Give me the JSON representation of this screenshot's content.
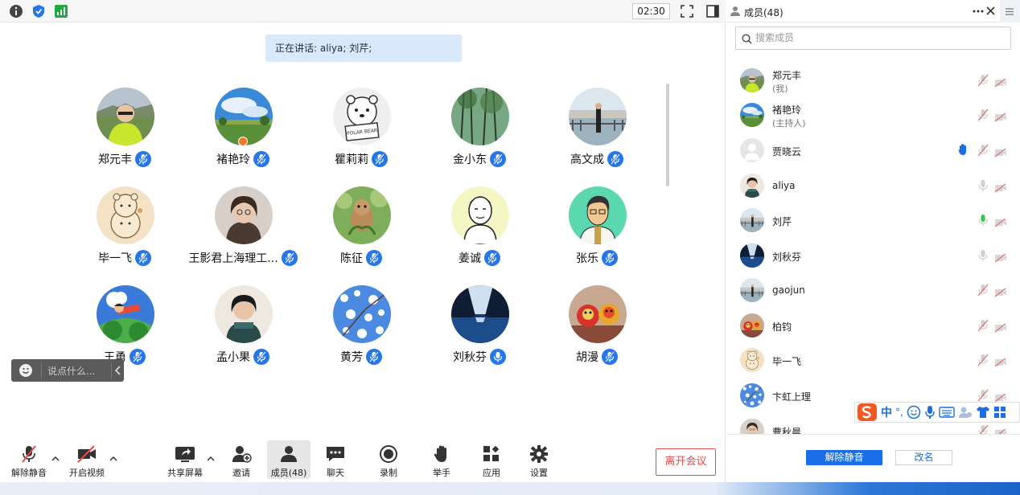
{
  "topbar": {
    "timer": "02:30"
  },
  "speaking": {
    "text": "正在讲话: aliya; 刘芹;"
  },
  "participants": [
    {
      "name": "郑元丰",
      "avatar": "cyclist"
    },
    {
      "name": "褚艳玲",
      "avatar": "landscape"
    },
    {
      "name": "瞿莉莉",
      "avatar": "polar-bear"
    },
    {
      "name": "金小东",
      "avatar": "trees"
    },
    {
      "name": "高文成",
      "avatar": "lakeside"
    },
    {
      "name": "毕一飞",
      "avatar": "bears"
    },
    {
      "name": "王影君上海理工...",
      "avatar": "portrait"
    },
    {
      "name": "陈征",
      "avatar": "squirrel"
    },
    {
      "name": "姜诚",
      "avatar": "sketch"
    },
    {
      "name": "张乐",
      "avatar": "cartoon"
    },
    {
      "name": "王勇",
      "avatar": "boy"
    },
    {
      "name": "孟小果",
      "avatar": "woman"
    },
    {
      "name": "黄芳",
      "avatar": "blossoms"
    },
    {
      "name": "刘秋芬",
      "avatar": "fjord"
    },
    {
      "name": "胡漫",
      "avatar": "lions"
    }
  ],
  "chat": {
    "placeholder": "说点什么..."
  },
  "toolbar": {
    "unmute": "解除静音",
    "video": "开启视频",
    "share": "共享屏幕",
    "invite": "邀请",
    "members": "成员(48)",
    "chat": "聊天",
    "record": "录制",
    "raise_hand": "举手",
    "apps": "应用",
    "settings": "设置",
    "leave": "离开会议"
  },
  "panel": {
    "title": "成员(48)",
    "search_placeholder": "搜索成员",
    "members": [
      {
        "name": "郑元丰",
        "role": "(我)",
        "mic": "muted",
        "cam": "off"
      },
      {
        "name": "褚艳玲",
        "role": "(主持人)",
        "mic": "muted",
        "cam": "off"
      },
      {
        "name": "贾晓云",
        "role": "",
        "mic": "muted",
        "cam": "off",
        "hand": true
      },
      {
        "name": "aliya",
        "role": "",
        "mic": "on",
        "cam": "off"
      },
      {
        "name": "刘芹",
        "role": "",
        "mic": "speaking",
        "cam": "off"
      },
      {
        "name": "刘秋芬",
        "role": "",
        "mic": "on",
        "cam": "off"
      },
      {
        "name": "gaojun",
        "role": "",
        "mic": "muted",
        "cam": "off"
      },
      {
        "name": "柏钧",
        "role": "",
        "mic": "muted",
        "cam": "off"
      },
      {
        "name": "毕一飞",
        "role": "",
        "mic": "muted",
        "cam": "off"
      },
      {
        "name": "卞虹上理",
        "role": "",
        "mic": "muted",
        "cam": "off"
      },
      {
        "name": "曹秋晨",
        "role": "",
        "mic": "muted",
        "cam": "off"
      }
    ],
    "unmute_all": "解除静音",
    "rename": "改名"
  },
  "ime": {
    "lang": "中",
    "punct": "°,"
  },
  "colors": {
    "accent": "#1a6fe8",
    "leave": "#e24b4b",
    "speaking_bg": "#d9e9fb"
  }
}
